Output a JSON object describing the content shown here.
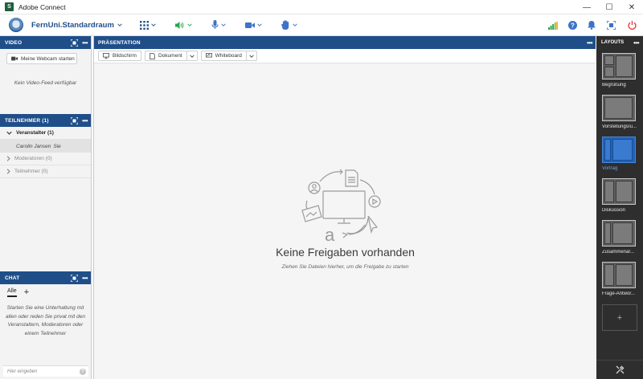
{
  "window": {
    "title": "Adobe Connect",
    "icon_letter": "S"
  },
  "toolbar": {
    "room_name": "FernUni.Standardraum",
    "buttons": [
      {
        "icon": "grid-icon",
        "color": "#1f4e89"
      },
      {
        "icon": "speaker-icon",
        "color": "#2aa64c"
      },
      {
        "icon": "microphone-icon",
        "color": "#3d73c9"
      },
      {
        "icon": "camera-icon",
        "color": "#3d73c9"
      },
      {
        "icon": "raise-hand-icon",
        "color": "#3d73c9"
      }
    ],
    "right_icons": [
      "signal-strength-icon",
      "help-icon",
      "notification-bell-icon",
      "fullscreen-icon",
      "power-icon"
    ]
  },
  "video_pod": {
    "title": "VIDEO",
    "webcam_button": "Meine Webcam starten",
    "no_feed": "Kein Video-Feed verfügbar"
  },
  "attendee_pod": {
    "title": "TEILNEHMER  (1)",
    "groups": [
      {
        "label": "Veranstalter (1)",
        "expanded": true
      },
      {
        "label": "Moderatoren (0)",
        "expanded": false
      },
      {
        "label": "Teilnehmer (0)",
        "expanded": false
      }
    ],
    "host_user": {
      "name": "Carolin Jansen",
      "suffix": "Sie"
    }
  },
  "chat_pod": {
    "title": "CHAT",
    "tab_all": "Alle",
    "add_tab": "+",
    "hint": "Starten Sie eine Unterhaltung mit allen oder reden Sie privat mit den Veranstaltern, Moderatoren oder einem Teilnehmer",
    "input_placeholder": "Hier eingeben",
    "help_icon": "?"
  },
  "presentation_pod": {
    "title": "PRÄSENTATION",
    "share_buttons": [
      {
        "label": "Bildschirm",
        "icon": "screen-icon"
      },
      {
        "label": "Dokument",
        "icon": "document-icon"
      },
      {
        "label": "Whiteboard",
        "icon": "whiteboard-icon"
      }
    ],
    "empty_title": "Keine Freigaben vorhanden",
    "empty_subtitle": "Ziehen Sie Dateien hierher, um die Freigabe zu starten"
  },
  "layouts_panel": {
    "title": "LAYOUTS",
    "items": [
      {
        "label": "Begrüßung",
        "active": false
      },
      {
        "label": "Vorstellungsru...",
        "active": false
      },
      {
        "label": "Vortrag",
        "active": true
      },
      {
        "label": "Diskussion",
        "active": false
      },
      {
        "label": "Zusammenar...",
        "active": false
      },
      {
        "label": "Frage-Antwor...",
        "active": false
      }
    ],
    "add_label": "+",
    "active_color": "#2063b8"
  },
  "colors": {
    "pod_header": "#1f4e89",
    "sidebar_bg": "#2e2e2e",
    "accent_blue": "#3d73c9"
  }
}
